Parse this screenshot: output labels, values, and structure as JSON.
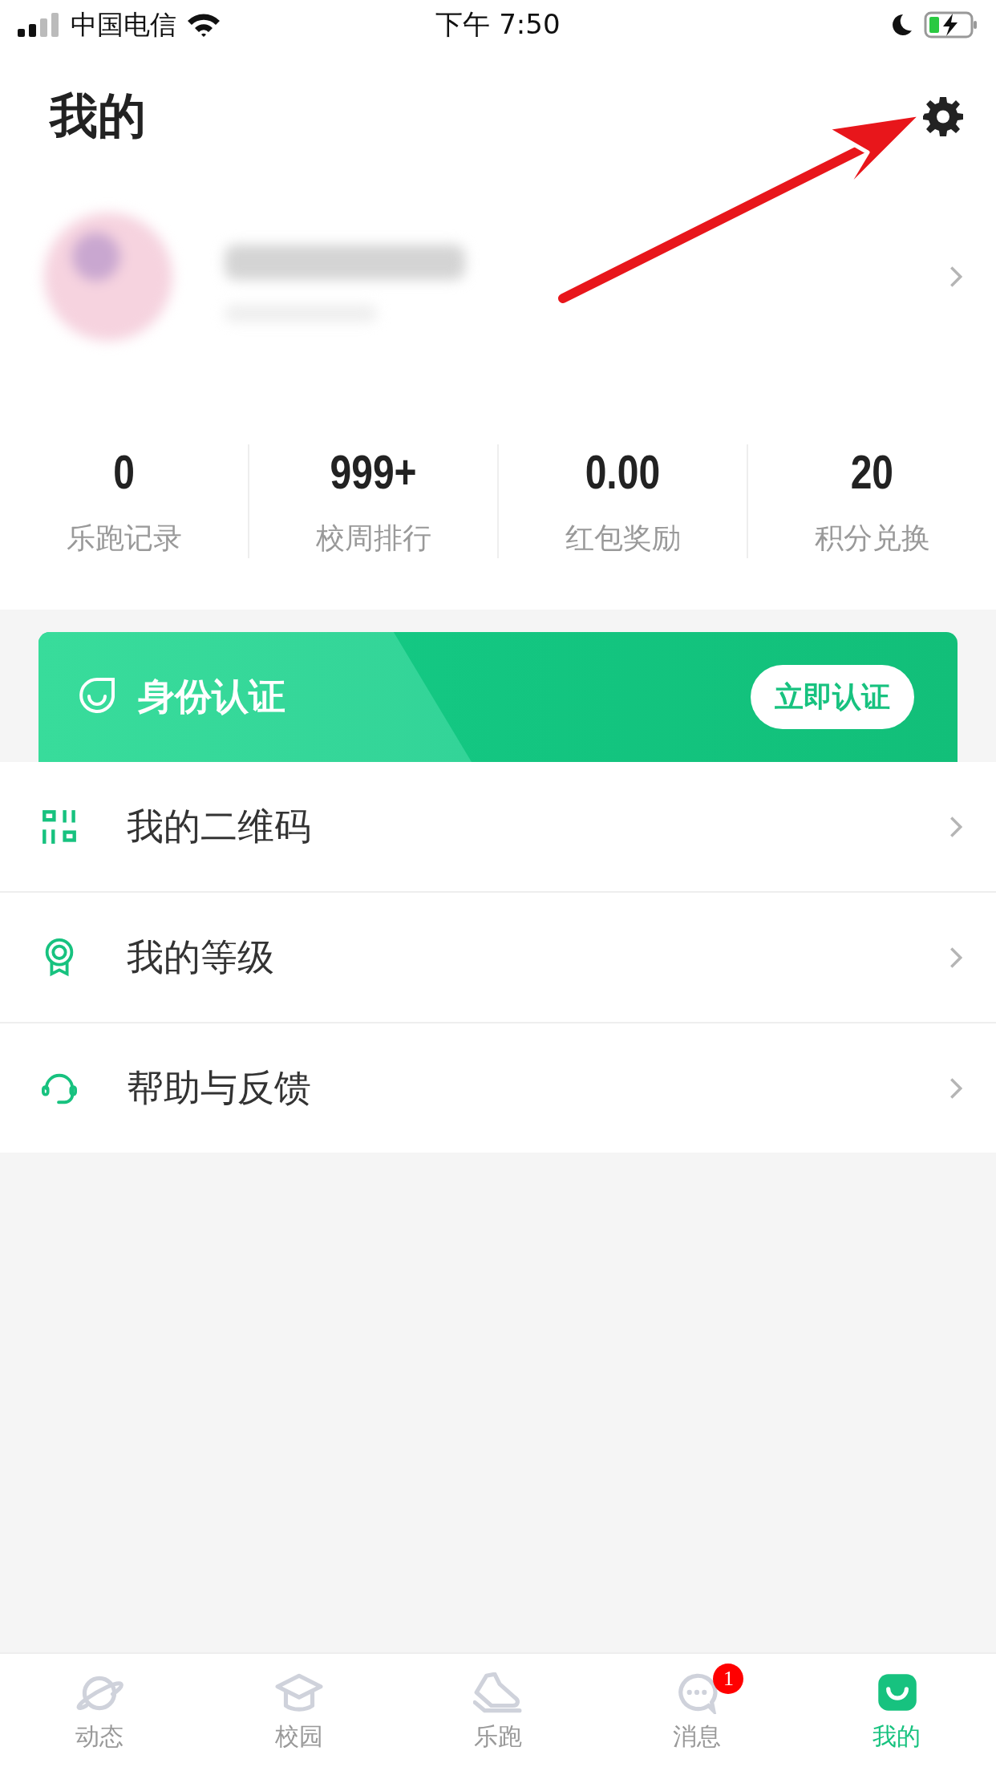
{
  "status_bar": {
    "carrier": "中国电信",
    "time": "下午 7:50"
  },
  "title": "我的",
  "stats": [
    {
      "value": "0",
      "label": "乐跑记录"
    },
    {
      "value": "999+",
      "label": "校周排行"
    },
    {
      "value": "0.00",
      "label": "红包奖励"
    },
    {
      "value": "20",
      "label": "积分兑换"
    }
  ],
  "banner": {
    "title": "身份认证",
    "button": "立即认证"
  },
  "menu": [
    {
      "kind": "qrcode",
      "label": "我的二维码"
    },
    {
      "kind": "medal",
      "label": "我的等级"
    },
    {
      "kind": "headset",
      "label": "帮助与反馈"
    }
  ],
  "tabs": [
    {
      "kind": "planet",
      "label": "动态",
      "selected": false
    },
    {
      "kind": "cap",
      "label": "校园",
      "selected": false
    },
    {
      "kind": "shoe",
      "label": "乐跑",
      "selected": false
    },
    {
      "kind": "chat",
      "label": "消息",
      "selected": false,
      "badge": "1"
    },
    {
      "kind": "me",
      "label": "我的",
      "selected": true
    }
  ]
}
